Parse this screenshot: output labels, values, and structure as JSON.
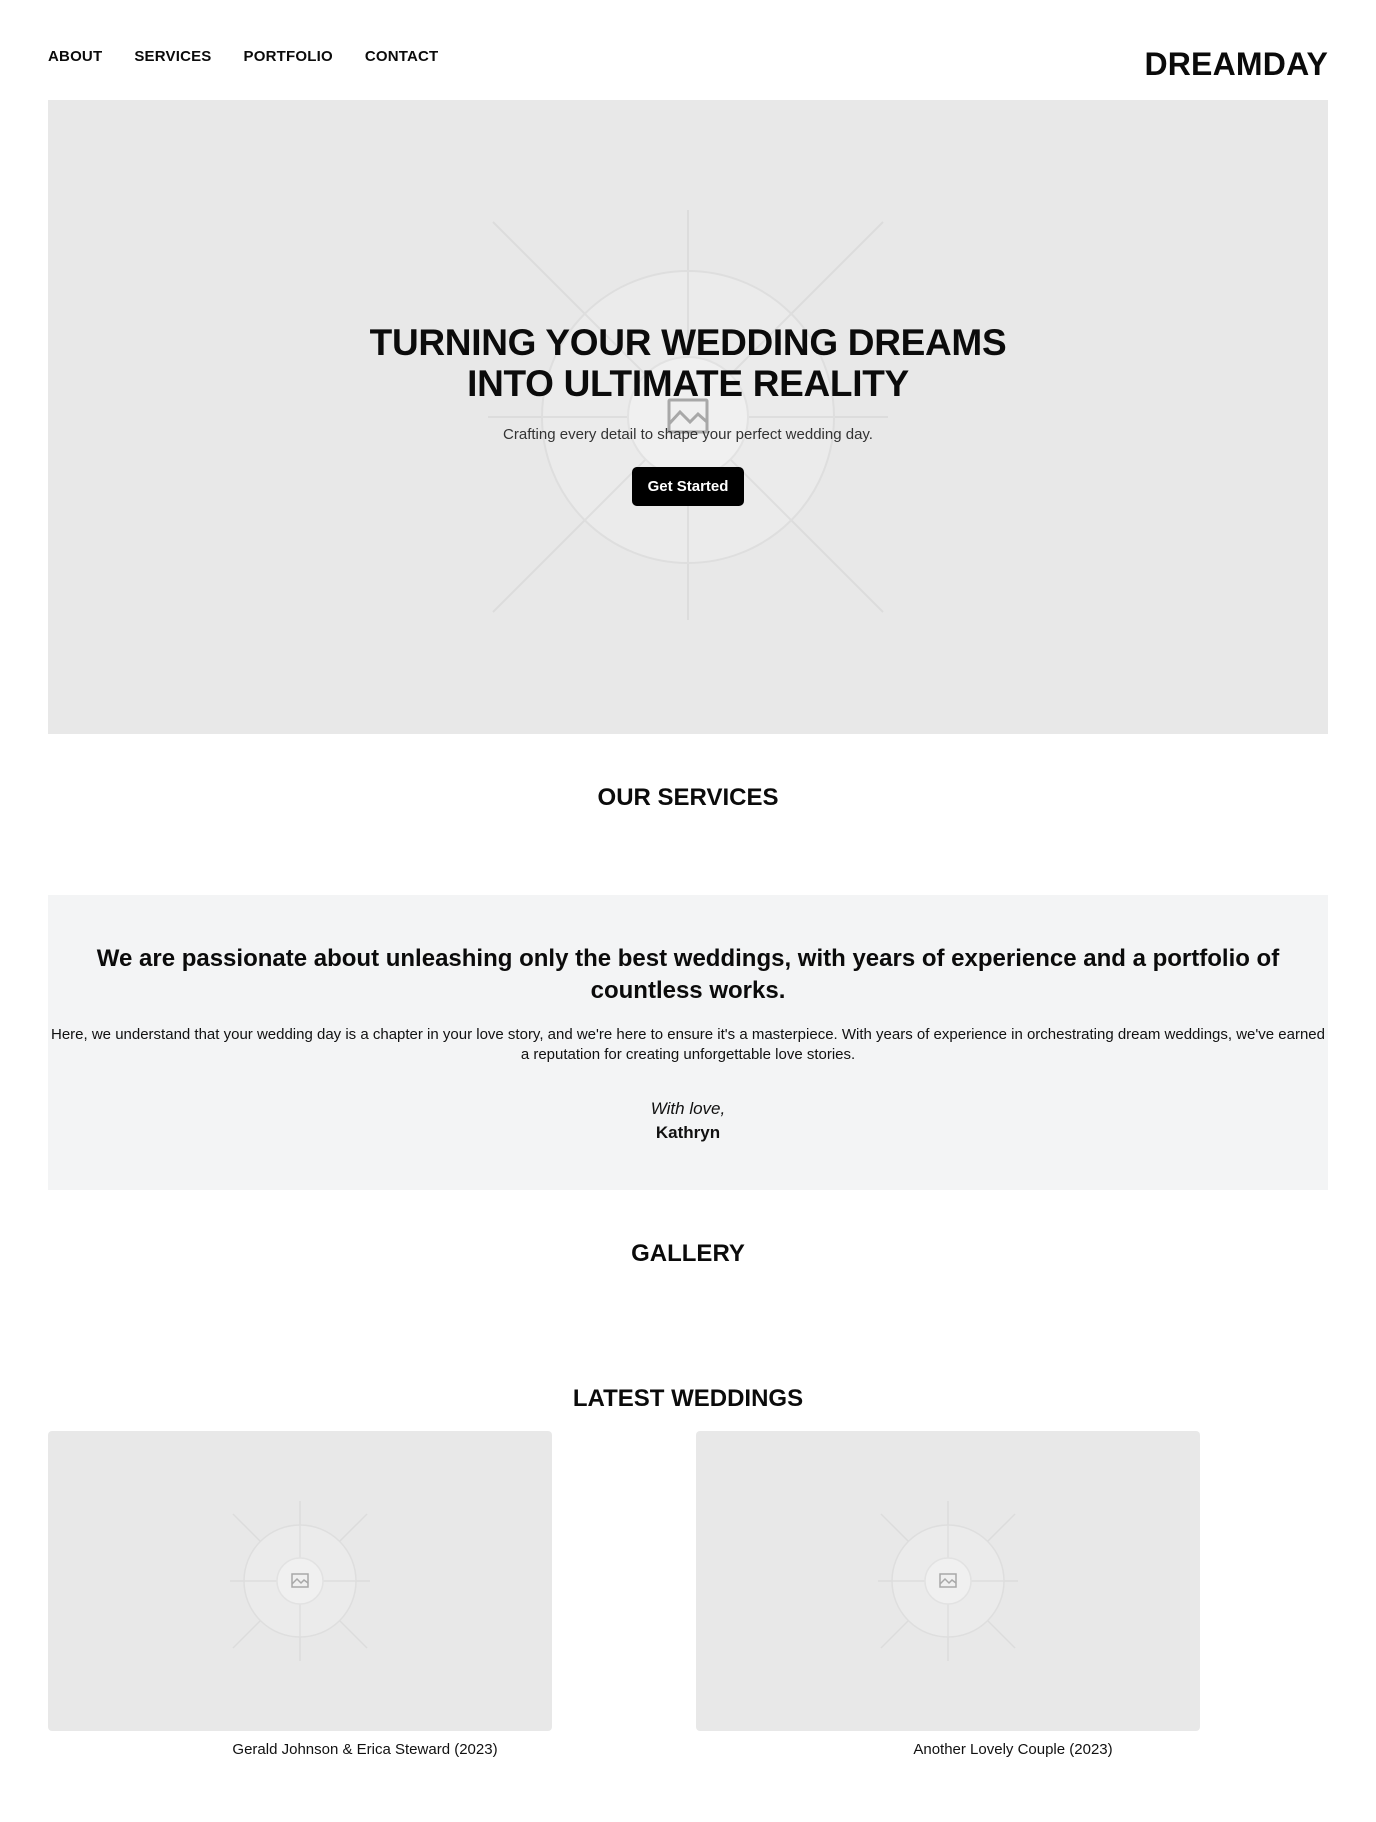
{
  "nav": {
    "items": [
      {
        "label": "ABOUT"
      },
      {
        "label": "SERVICES"
      },
      {
        "label": "PORTFOLIO"
      },
      {
        "label": "CONTACT"
      }
    ],
    "logo": "DREAMDAY"
  },
  "hero": {
    "title": "TURNING YOUR WEDDING DREAMS INTO ULTIMATE REALITY",
    "subtitle": "Crafting every detail to shape your perfect wedding day.",
    "cta_label": "Get Started",
    "image_icon": "image-placeholder-icon"
  },
  "services": {
    "title": "OUR SERVICES"
  },
  "about": {
    "heading": "We are passionate about unleashing only the best weddings, with years of experience and a portfolio of countless works.",
    "body": "Here, we understand that your wedding day is a chapter in your love story, and we're here to ensure it's a masterpiece. With years of experience in orchestrating dream weddings, we've earned a reputation for creating unforgettable love stories.",
    "sign_off": "With love,",
    "name": "Kathryn"
  },
  "gallery": {
    "title": "GALLERY"
  },
  "latest": {
    "title": "LATEST WEDDINGS",
    "cards": [
      {
        "caption": "Gerald Johnson & Erica Steward (2023)"
      },
      {
        "caption": "Another Lovely Couple (2023)"
      }
    ]
  },
  "colors": {
    "placeholder_bg": "#e8e8e8",
    "band_bg": "#f3f4f5",
    "button_bg": "#000000",
    "text": "#0b0b0b"
  }
}
